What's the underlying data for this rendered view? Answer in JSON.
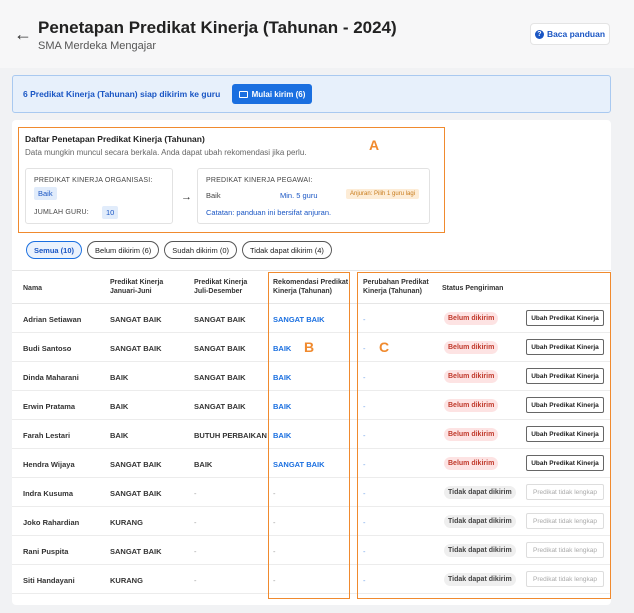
{
  "header": {
    "title": "Penetapan Predikat Kinerja (Tahunan - 2024)",
    "school": "SMA Merdeka Mengajar",
    "guide_label": "Baca panduan"
  },
  "banner": {
    "text": "6 Predikat Kinerja (Tahunan) siap dikirim ke guru",
    "send_label": "Mulai kirim (6)"
  },
  "card": {
    "title": "Daftar Penetapan Predikat Kinerja (Tahunan)",
    "subtitle": "Data mungkin muncul secara berkala. Anda dapat ubah rekomendasi jika perlu.",
    "org_label": "PREDIKAT KINERJA ORGANISASI:",
    "org_value": "Baik",
    "teacher_count_label": "JUMLAH GURU:",
    "teacher_count": "10",
    "employee_label": "PREDIKAT KINERJA PEGAWAI:",
    "employee_value": "Baik",
    "min_teachers": "Min. 5 guru",
    "suggestion": "Anjuran: Pilih 1 guru lagi",
    "note": "Catatan: panduan ini bersifat anjuran."
  },
  "annotations": {
    "a": "A",
    "b": "B",
    "c": "C"
  },
  "filters": [
    {
      "label": "Semua (10)",
      "active": true
    },
    {
      "label": "Belum dikirim (6)",
      "active": false
    },
    {
      "label": "Sudah dikirim (0)",
      "active": false
    },
    {
      "label": "Tidak dapat dikirim (4)",
      "active": false
    }
  ],
  "columns": {
    "name": "Nama",
    "h1": "Predikat Kinerja Januari-Juni",
    "h2": "Predikat Kinerja Juli-Desember",
    "rec": "Rekomendasi Predikat Kinerja (Tahunan)",
    "change": "Perubahan Predikat Kinerja (Tahunan)",
    "status": "Status Pengiriman"
  },
  "rows": [
    {
      "name": "Adrian Setiawan",
      "h1": "SANGAT BAIK",
      "h2": "SANGAT BAIK",
      "rec": "SANGAT BAIK",
      "change": "-",
      "status": "Belum dikirim",
      "action": "Ubah Predikat Kinerja"
    },
    {
      "name": "Budi Santoso",
      "h1": "SANGAT BAIK",
      "h2": "SANGAT BAIK",
      "rec": "BAIK",
      "change": "-",
      "status": "Belum dikirim",
      "action": "Ubah Predikat Kinerja"
    },
    {
      "name": "Dinda Maharani",
      "h1": "BAIK",
      "h2": "SANGAT BAIK",
      "rec": "BAIK",
      "change": "-",
      "status": "Belum dikirim",
      "action": "Ubah Predikat Kinerja"
    },
    {
      "name": "Erwin Pratama",
      "h1": "BAIK",
      "h2": "SANGAT BAIK",
      "rec": "BAIK",
      "change": "-",
      "status": "Belum dikirim",
      "action": "Ubah Predikat Kinerja"
    },
    {
      "name": "Farah Lestari",
      "h1": "BAIK",
      "h2": "BUTUH PERBAIKAN",
      "rec": "BAIK",
      "change": "-",
      "status": "Belum dikirim",
      "action": "Ubah Predikat Kinerja"
    },
    {
      "name": "Hendra Wijaya",
      "h1": "SANGAT BAIK",
      "h2": "BAIK",
      "rec": "SANGAT BAIK",
      "change": "-",
      "status": "Belum dikirim",
      "action": "Ubah Predikat Kinerja"
    },
    {
      "name": "Indra Kusuma",
      "h1": "SANGAT BAIK",
      "h2": "-",
      "rec": "-",
      "change": "-",
      "status": "Tidak dapat dikirim",
      "action": "Predikat tidak lengkap"
    },
    {
      "name": "Joko Rahardian",
      "h1": "KURANG",
      "h2": "-",
      "rec": "-",
      "change": "-",
      "status": "Tidak dapat dikirim",
      "action": "Predikat tidak lengkap"
    },
    {
      "name": "Rani Puspita",
      "h1": "SANGAT BAIK",
      "h2": "-",
      "rec": "-",
      "change": "-",
      "status": "Tidak dapat dikirim",
      "action": "Predikat tidak lengkap"
    },
    {
      "name": "Siti Handayani",
      "h1": "KURANG",
      "h2": "-",
      "rec": "-",
      "change": "-",
      "status": "Tidak dapat dikirim",
      "action": "Predikat tidak lengkap"
    }
  ],
  "colors": {
    "accent": "#1a6fe0",
    "annotation": "#f08a2e",
    "not_sent": "#c0392b"
  }
}
